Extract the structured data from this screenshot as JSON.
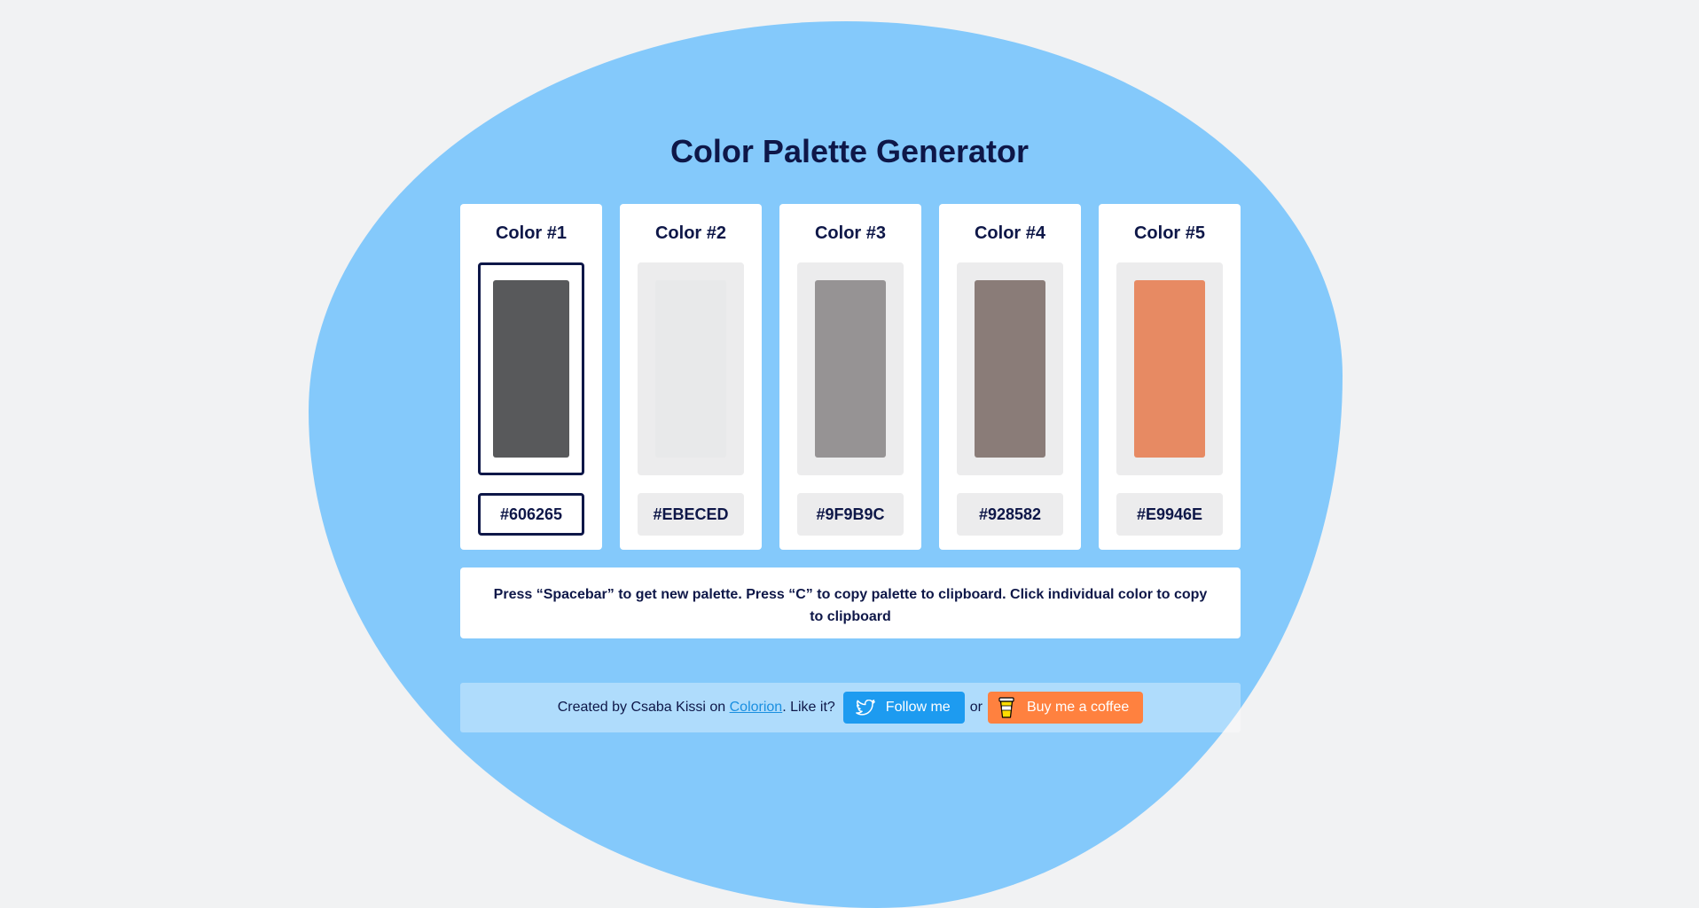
{
  "page": {
    "title": "Color Palette Generator"
  },
  "palette": [
    {
      "label": "Color #1",
      "hex": "#606265",
      "swatch_color": "#58595b",
      "active": true
    },
    {
      "label": "Color #2",
      "hex": "#EBECED",
      "swatch_color": "#e8e9ea",
      "active": false
    },
    {
      "label": "Color #3",
      "hex": "#9F9B9C",
      "swatch_color": "#969394",
      "active": false
    },
    {
      "label": "Color #4",
      "hex": "#928582",
      "swatch_color": "#8a7c78",
      "active": false
    },
    {
      "label": "Color #5",
      "hex": "#E9946E",
      "swatch_color": "#e78a63",
      "active": false
    }
  ],
  "instructions": {
    "text": "Press “Spacebar” to get new palette. Press “C” to copy palette to clipboard. Click individual color to copy to clipboard"
  },
  "footer": {
    "created_by": "Created by Csaba Kissi on ",
    "link_text": "Colorion",
    "like_text": ". Like it?",
    "follow_label": "Follow me",
    "or_text": "or",
    "coffee_label": "Buy me a coffee",
    "follow_icon": "twitter-bird-icon",
    "coffee_icon": "coffee-cup-icon"
  },
  "colors": {
    "background": "#f1f2f3",
    "blob": "#84c9fb",
    "text_dark": "#0e1748",
    "twitter_blue": "#1d9bf0",
    "coffee_orange": "#ff813f",
    "link_blue": "#1a8fe0"
  }
}
